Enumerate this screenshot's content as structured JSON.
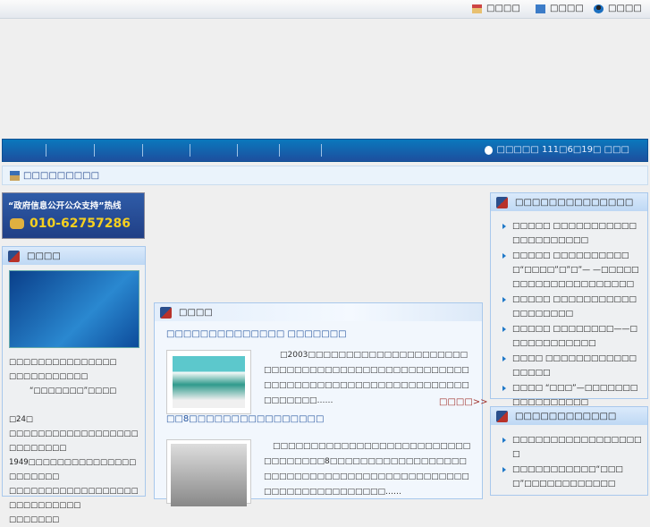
{
  "top_links": [
    {
      "icon": "home-icon",
      "label": "□□□□"
    },
    {
      "icon": "folder-icon",
      "label": "□□□□"
    },
    {
      "icon": "user-icon",
      "label": "□□□□"
    }
  ],
  "nav": {
    "date": "□□□□□ 111□6□19□ □□□"
  },
  "breadcrumb": "□□□□□□□□□",
  "hotline": {
    "title": "“政府信息公开公众支持”热线",
    "phone": "010-62757286"
  },
  "left_panel": {
    "title": "□□□□",
    "lines": [
      "□□□□□□□□□□□□□□□",
      "□□□□□□□□□□□",
      "“□□□□□□□”□□□□",
      "□24□",
      "□□□□□□□□□□□□□□□□□□□□□□□□□□",
      "1949□□□□□□□□□□□□□□□□□□□□□□",
      "□□□□□□□□□□□□□□□□□□□□□□□□□□□□",
      "□□□□□□□"
    ]
  },
  "center_panel": {
    "title": "□□□□",
    "news": [
      {
        "title": "□□□□□□□□□□□□□□ □□□□□□□",
        "text": "□2003□□□□□□□□□□□□□□□□□□□□□□□□□□□□□□□□□□□□□□□□□□□□□□□□□□□□□□□□□□□□□□□□□□□□□□□□□□□□□□□□□□……",
        "more": "□□□□>>"
      },
      {
        "title": "□□8□□□□□□□□□□□□□□□□",
        "text": "□□□□□□□□□□□□□□□□□□□□□□□□□□□□□□□□□□8□□□□□□□□□□□□□□□□□□□□□□□□□□□□□□□□□□□□□□□□□□□□□□□□□□□□□□□□□□□□□……"
      }
    ]
  },
  "right_panel1": {
    "title": "□□□□□□□□□□□□□□",
    "items": [
      "□□□□□ □□□□□□□□□□□□□□□□□□□□□",
      "□□□□□ □□□□□□□□□□□“□□□□”□”□”—  —□□□□□□□□□□□□□□□□□□□□□",
      "□□□□□ □□□□□□□□□□□□□□□□□□□",
      "□□□□□ □□□□□□□□——□□□□□□□□□□□□",
      "□□□□ □□□□□□□□□□□□□□□□□",
      "□□□□ “□□□”—□□□□□□□□□□□□□□□□□",
      "□□□□ □□□□□□□□□",
      "□□□□ □□“□□□□□□”",
      "□□□□ “□□□—□□□□□□□□”"
    ]
  },
  "right_panel2": {
    "title": "□□□□□□□□□□□□",
    "items": [
      "□□□□□□□□□□□□□□□□□□",
      "□□□□□□□□□□□“□□□□”□□□□□□□□□□□□"
    ]
  }
}
